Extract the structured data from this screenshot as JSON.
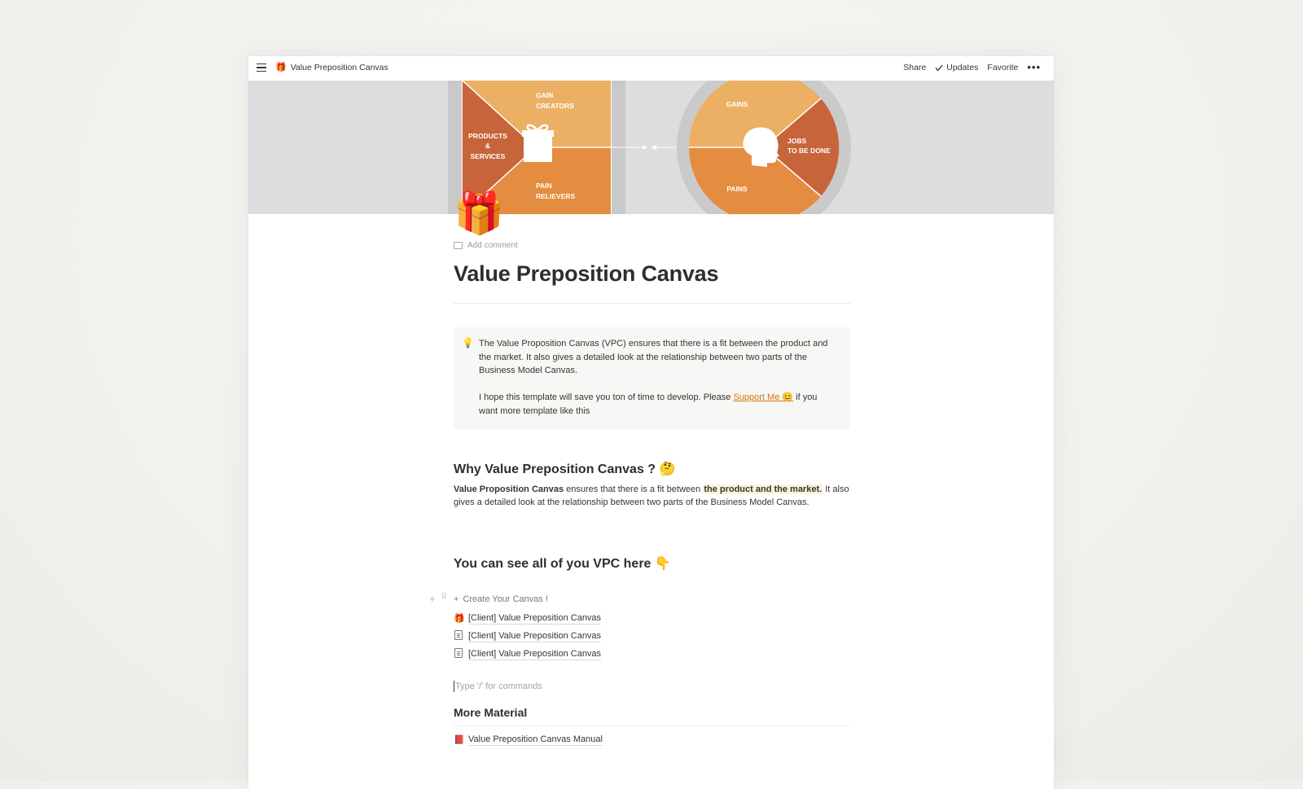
{
  "topbar": {
    "breadcrumb_emoji": "🎁",
    "breadcrumb_title": "Value Preposition Canvas",
    "share": "Share",
    "updates": "Updates",
    "favorite": "Favorite",
    "more": "•••"
  },
  "cover": {
    "left_labels": {
      "gain_creators_1": "GAIN",
      "gain_creators_2": "CREATORS",
      "products_1": "PRODUCTS",
      "products_2": "&",
      "products_3": "SERVICES",
      "pain_relievers_1": "PAIN",
      "pain_relievers_2": "RELIEVERS"
    },
    "right_labels": {
      "gains": "GAINS",
      "jobs_1": "JOBS",
      "jobs_2": "TO BE DONE",
      "pains": "PAINS"
    }
  },
  "page": {
    "icon": "🎁",
    "add_comment": "Add comment",
    "title": "Value Preposition Canvas"
  },
  "callout": {
    "icon": "💡",
    "para1": "The Value Proposition Canvas (VPC) ensures that there is a fit between the product and the market. It also gives a detailed look at the relationship between two parts of the Business Model Canvas.",
    "para2_before": "I hope this template will save you ton of  time to develop. Please ",
    "support_link": "Support Me 😊",
    "para2_after": " if you want more template like this"
  },
  "why": {
    "heading": "Why Value Preposition Canvas ? 🤔",
    "bold_lead": "Value Proposition Canvas",
    "text1": " ensures that there is a fit between ",
    "highlight": "the product and the market.",
    "text2": " It also gives a detailed look at the relationship between two parts of the Business Model Canvas."
  },
  "vpc": {
    "heading": "You can see all of you VPC here 👇",
    "create_label": "Create Your Canvas !",
    "items": [
      {
        "icon": "🎁",
        "label": "[Client] Value Preposition Canvas"
      },
      {
        "icon": "doc",
        "label": "[Client] Value Preposition Canvas"
      },
      {
        "icon": "doc",
        "label": "[Client] Value Preposition Canvas"
      }
    ]
  },
  "editor": {
    "placeholder": "Type '/' for commands"
  },
  "more_material": {
    "heading": "More Material",
    "link_icon": "📕",
    "link_label": "Value Preposition Canvas Manual"
  },
  "colors": {
    "orange_dark": "#c8643a",
    "orange_mid": "#e48c3f",
    "orange_light": "#ebb063",
    "accent_link": "#d9730d"
  }
}
